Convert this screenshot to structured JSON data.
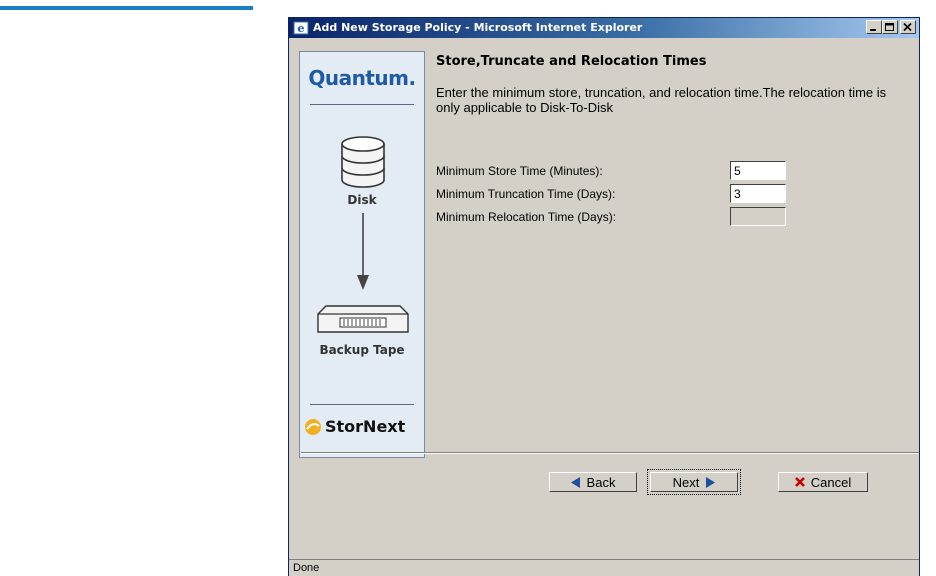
{
  "window": {
    "title": "Add New Storage Policy - Microsoft Internet Explorer"
  },
  "sidebar": {
    "logo": "Quantum.",
    "disk_label": "Disk",
    "tape_label": "Backup Tape",
    "brand": "StorNext"
  },
  "content": {
    "heading": "Store,Truncate and Relocation Times",
    "instructions": "Enter the minimum store, truncation, and relocation time.The relocation time is only applicable to Disk-To-Disk",
    "fields": [
      {
        "label": "Minimum Store Time (Minutes):",
        "value": "5"
      },
      {
        "label": "Minimum Truncation Time (Days):",
        "value": "3"
      },
      {
        "label": "Minimum Relocation Time (Days):",
        "value": ""
      }
    ]
  },
  "buttons": {
    "back": "Back",
    "next": "Next",
    "cancel": "Cancel"
  },
  "status": {
    "text": "Done"
  },
  "colors": {
    "title_bar": "#0a246a",
    "doc_rule": "#1d7fc3",
    "logo": "#1f5aa6",
    "arrow_blue": "#1f4fa0",
    "cancel_x": "#cc0000"
  }
}
